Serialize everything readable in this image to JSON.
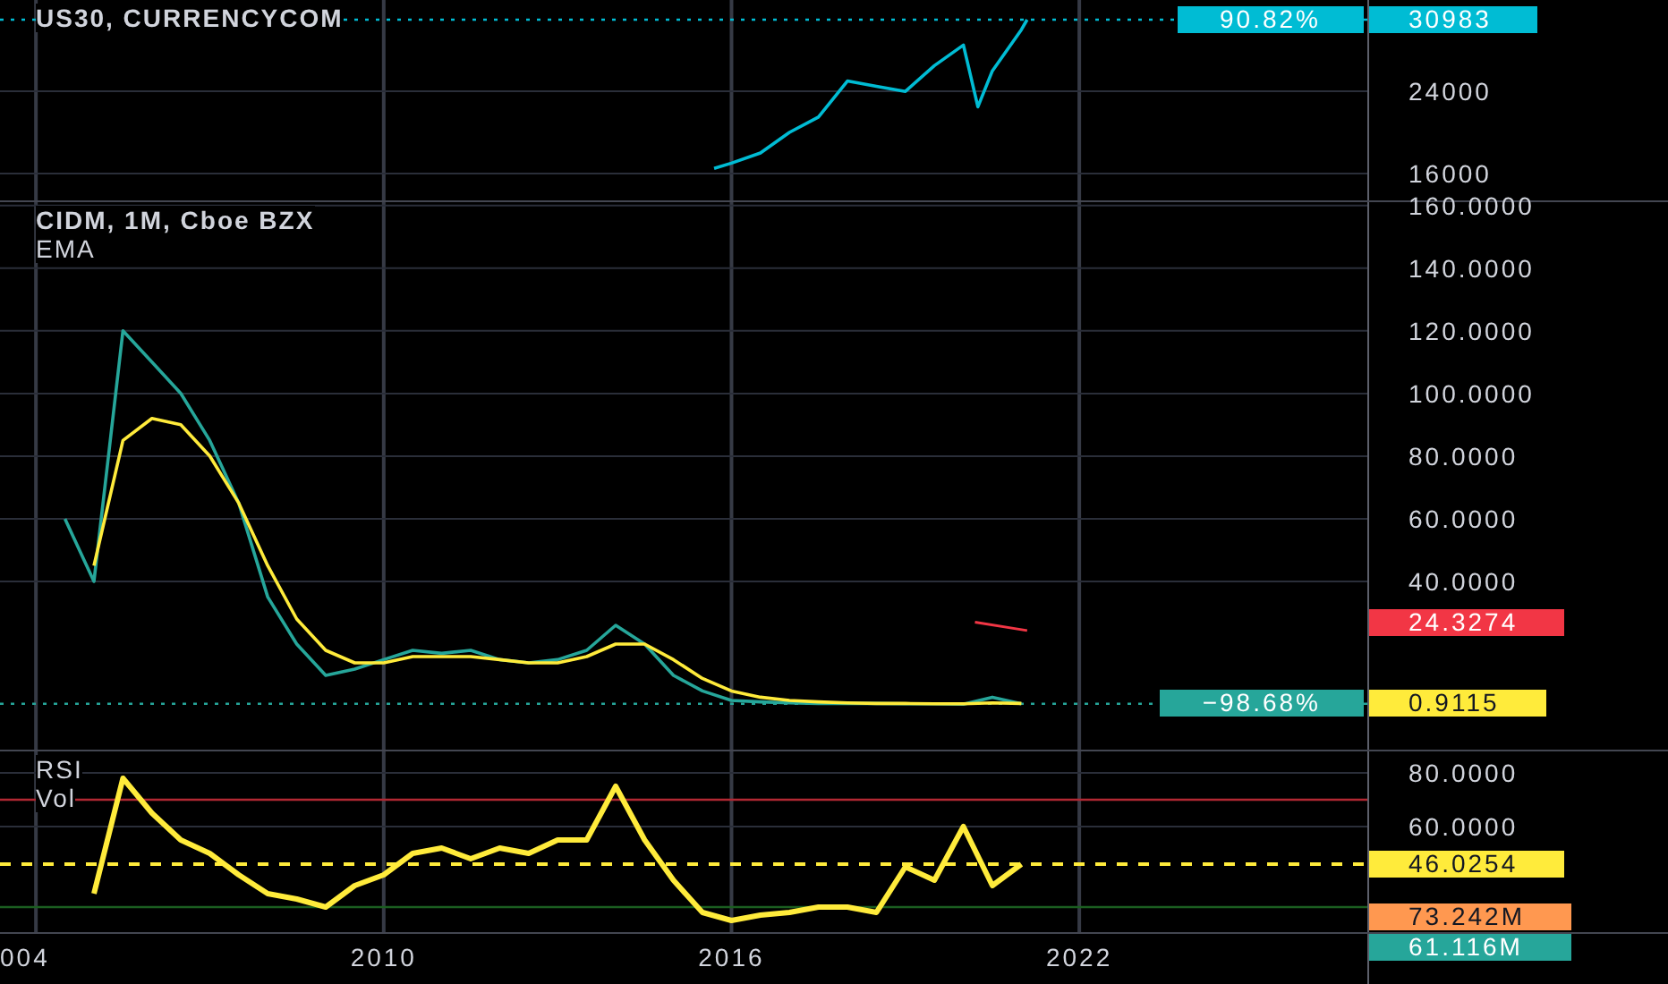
{
  "panes": [
    {
      "legend": [
        {
          "kind": "symbol",
          "text": "US30, CURRENCYCOM"
        }
      ],
      "axis_labels": [
        "24000",
        "16000"
      ],
      "tags": [
        {
          "kind": "percent_change",
          "label": "90.82%",
          "color": "#00bcd4"
        },
        {
          "kind": "last_price",
          "label": "30983",
          "color": "#00bcd4"
        }
      ]
    },
    {
      "legend": [
        {
          "kind": "symbol",
          "text": "CIDM, 1M, Cboe BZX"
        },
        {
          "kind": "indicator",
          "text": "EMA"
        }
      ],
      "axis_labels": [
        "160.0000",
        "140.0000",
        "120.0000",
        "100.0000",
        "80.0000",
        "60.0000",
        "40.0000"
      ],
      "tags": [
        {
          "kind": "drawing",
          "label": "24.3274",
          "color": "#f23645"
        },
        {
          "kind": "percent_change",
          "label": "−98.68%",
          "color": "#26a69a"
        },
        {
          "kind": "last_price",
          "label": "0.9115",
          "color": "#ffeb3b"
        }
      ]
    },
    {
      "legend": [
        {
          "kind": "indicator",
          "text": "RSI"
        },
        {
          "kind": "indicator",
          "text": "Vol"
        }
      ],
      "axis_labels": [
        "80.0000",
        "60.0000"
      ],
      "tags": [
        {
          "kind": "last_price",
          "label": "46.0254",
          "color": "#ffeb3b"
        },
        {
          "kind": "volume",
          "label": "73.242M",
          "color": "#ff9850"
        },
        {
          "kind": "volume",
          "label": "61.116M",
          "color": "#26a69a"
        }
      ]
    }
  ],
  "time_axis": [
    "004",
    "2010",
    "2016",
    "2022"
  ]
}
